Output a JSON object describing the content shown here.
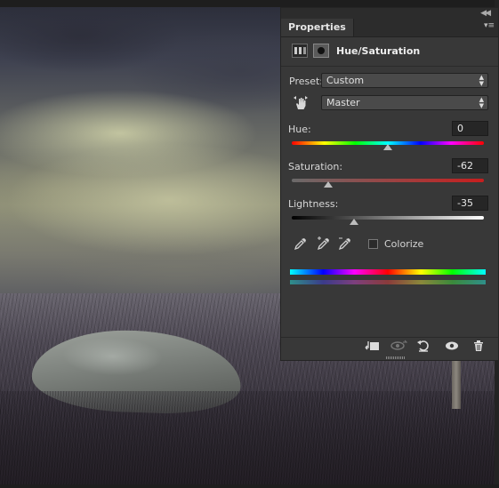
{
  "panel": {
    "tab_title": "Properties",
    "adjustment_title": "Hue/Saturation",
    "preset": {
      "label": "Preset:",
      "value": "Custom"
    },
    "channel": {
      "value": "Master"
    },
    "hue": {
      "label": "Hue:",
      "value": "0",
      "fraction": 0.5
    },
    "saturation": {
      "label": "Saturation:",
      "value": "-62",
      "fraction": 0.19
    },
    "lightness": {
      "label": "Lightness:",
      "value": "-35",
      "fraction": 0.325
    },
    "colorize": {
      "label": "Colorize",
      "checked": false
    },
    "icons": {
      "adjustment": "adjustment-layer-icon",
      "mask": "mask-icon",
      "target": "targeted-adjustment-hand-icon",
      "droppers": [
        "eyedropper-icon",
        "eyedropper-plus-icon",
        "eyedropper-minus-icon"
      ],
      "footer": [
        "clip-to-layer-icon",
        "view-previous-state-icon",
        "reset-icon",
        "visibility-eye-icon",
        "trash-icon"
      ]
    }
  }
}
